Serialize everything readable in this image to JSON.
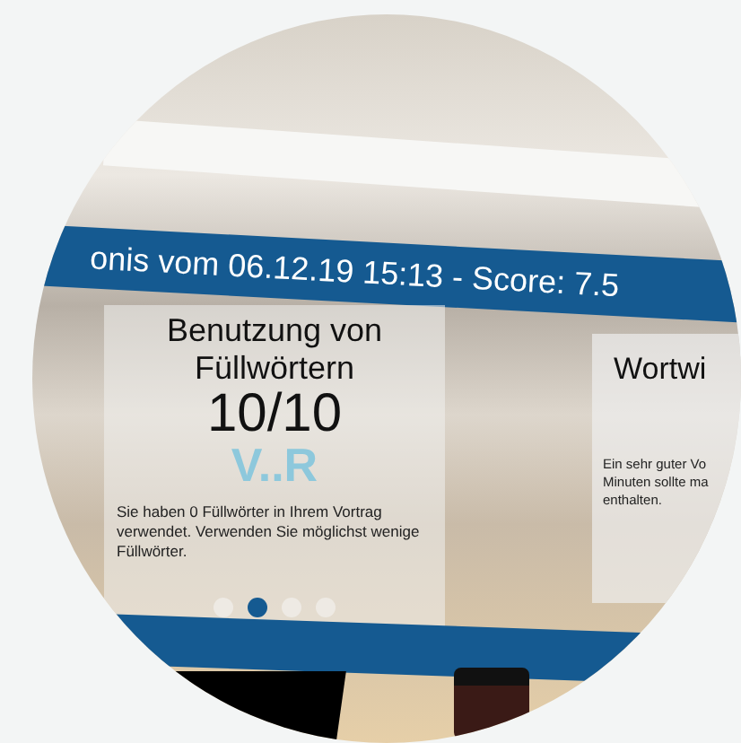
{
  "banner": {
    "title": "onis vom 06.12.19 15:13 - Score: 7.5"
  },
  "cards": [
    {
      "title": "Benutzung von Füllwörtern",
      "score": "10/10",
      "logo": "V..R",
      "description": "Sie haben 0 Füllwörter in Ihrem Vortrag verwendet. Verwenden Sie möglichst wenige Füllwörter."
    },
    {
      "title": "Wortwi",
      "description_lines": [
        "Ein sehr guter Vo",
        "Minuten sollte ma",
        "enthalten."
      ]
    }
  ],
  "pager": [
    {
      "selected": false
    },
    {
      "selected": true
    },
    {
      "selected": false
    },
    {
      "selected": false
    }
  ]
}
